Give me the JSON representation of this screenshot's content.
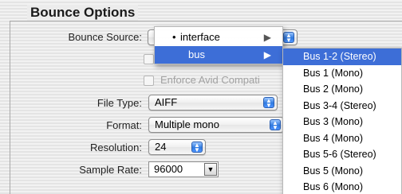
{
  "group_title": "Bounce Options",
  "bounce_source": {
    "label": "Bounce Source:",
    "menu": [
      {
        "label": "interface",
        "marked": true,
        "mark": "•"
      },
      {
        "label": "bus",
        "highlighted": true
      }
    ],
    "submenu_arrow": "▶",
    "submenu": [
      "Bus 1-2 (Stereo)",
      "Bus 1 (Mono)",
      "Bus 2 (Mono)",
      "Bus 3-4 (Stereo)",
      "Bus 3 (Mono)",
      "Bus 4 (Mono)",
      "Bus 5-6 (Stereo)",
      "Bus 5 (Mono)",
      "Bus 6 (Mono)"
    ]
  },
  "enforce_label": "Enforce Avid Compati",
  "file_type": {
    "label": "File Type:",
    "value": "AIFF"
  },
  "format": {
    "label": "Format:",
    "value": "Multiple mono"
  },
  "resolution": {
    "label": "Resolution:",
    "value": "24"
  },
  "sample_rate": {
    "label": "Sample Rate:",
    "value": "96000"
  },
  "colors": {
    "highlight": "#3d6ed7",
    "popup_arrow": "#2f79e0"
  },
  "icons": {
    "popup_arrows": "up-down-arrows-icon",
    "combo_arrow": "triangle-down-icon",
    "submenu": "triangle-right-icon"
  }
}
